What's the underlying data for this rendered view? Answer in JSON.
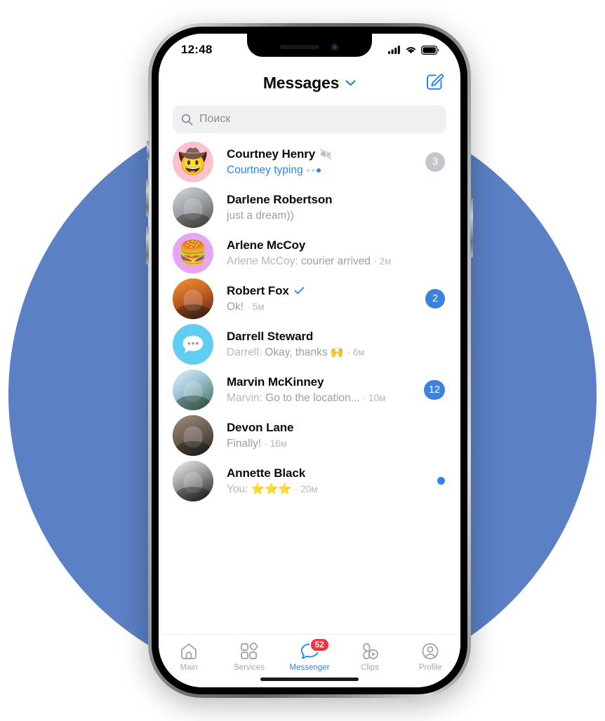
{
  "status_bar": {
    "time": "12:48",
    "icons": [
      "cellular-signal-icon",
      "wifi-icon",
      "battery-icon"
    ]
  },
  "nav": {
    "title": "Messages",
    "chevron_icon": "chevron-down-icon",
    "compose_icon": "compose-icon",
    "accent_color": "#2f84e8"
  },
  "search": {
    "placeholder": "Поиск",
    "icon": "search-icon"
  },
  "chats": [
    {
      "name": "Courtney Henry",
      "muted": true,
      "verified": false,
      "sender": "",
      "preview": "Courtney typing",
      "preview_style": "typing",
      "time": "",
      "badge": "3",
      "badge_color": "gray",
      "avatar_type": "emoji",
      "avatar_emoji": "🤠",
      "avatar_bg": "#f9c3cd"
    },
    {
      "name": "Darlene Robertson",
      "muted": false,
      "verified": false,
      "sender": "",
      "preview": "just a dream))",
      "preview_style": "normal",
      "time": "",
      "badge": "",
      "badge_color": "",
      "avatar_type": "photo",
      "avatar_emoji": "",
      "avatar_bg": "#b8bcc2"
    },
    {
      "name": "Arlene McCoy",
      "muted": false,
      "verified": false,
      "sender": "Arlene McCoy:",
      "preview": "courier arrived",
      "preview_style": "normal",
      "time": "· 2м",
      "badge": "",
      "badge_color": "",
      "avatar_type": "emoji",
      "avatar_emoji": "🍔",
      "avatar_bg": "#e5a6f7"
    },
    {
      "name": "Robert Fox",
      "muted": false,
      "verified": true,
      "sender": "",
      "preview": "Ok!",
      "preview_style": "normal",
      "time": "· 5м",
      "badge": "2",
      "badge_color": "blue",
      "avatar_type": "photo",
      "avatar_emoji": "",
      "avatar_bg": "#e07a33"
    },
    {
      "name": "Darrell Steward",
      "muted": false,
      "verified": false,
      "sender": "Darrell:",
      "preview": "Okay, thanks 🙌",
      "preview_style": "normal",
      "time": "· 6м",
      "badge": "",
      "badge_color": "",
      "avatar_type": "bubble",
      "avatar_emoji": "",
      "avatar_bg": "#62cdf3"
    },
    {
      "name": "Marvin McKinney",
      "muted": false,
      "verified": false,
      "sender": "Marvin:",
      "preview": "Go to the location...",
      "preview_style": "normal",
      "time": "· 10м",
      "badge": "12",
      "badge_color": "blue",
      "avatar_type": "photo",
      "avatar_emoji": "",
      "avatar_bg": "#cfd6dd"
    },
    {
      "name": "Devon Lane",
      "muted": false,
      "verified": false,
      "sender": "",
      "preview": "Finally!",
      "preview_style": "normal",
      "time": "· 16м",
      "badge": "",
      "badge_color": "",
      "avatar_type": "photo",
      "avatar_emoji": "",
      "avatar_bg": "#6d6257"
    },
    {
      "name": "Annette Black",
      "muted": false,
      "verified": false,
      "sender": "You:",
      "preview": "⭐⭐⭐",
      "preview_style": "normal",
      "time": "· 20м",
      "badge": "dot",
      "badge_color": "blue",
      "avatar_type": "photo",
      "avatar_emoji": "",
      "avatar_bg": "#8a8a8a"
    }
  ],
  "tabbar": {
    "items": [
      {
        "label": "Main",
        "icon": "home-icon",
        "active": false,
        "badge": ""
      },
      {
        "label": "Services",
        "icon": "grid-icon",
        "active": false,
        "badge": ""
      },
      {
        "label": "Messenger",
        "icon": "chat-bubble-icon",
        "active": true,
        "badge": "52"
      },
      {
        "label": "Clips",
        "icon": "clips-play-icon",
        "active": false,
        "badge": ""
      },
      {
        "label": "Profile",
        "icon": "person-circle-icon",
        "active": false,
        "badge": ""
      }
    ],
    "badge_color": "#f5333f",
    "active_color": "#2f84e8",
    "inactive_color": "#a4a8ae"
  },
  "theme": {
    "background_circle_color": "#5b80c4",
    "page_background": "#ffffff"
  }
}
